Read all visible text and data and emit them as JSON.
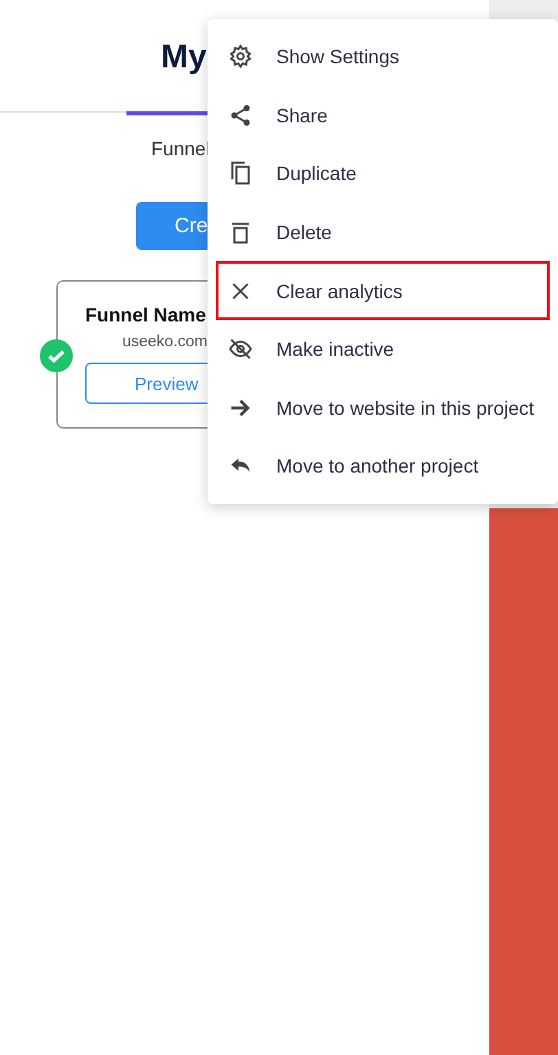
{
  "page": {
    "title": "My",
    "tab_label": "Funnel",
    "create_button": "Cre"
  },
  "funnel_card": {
    "name": "Funnel Name",
    "domain": "useeko.com",
    "active": true,
    "preview_button": "Preview"
  },
  "context_menu": {
    "items": [
      {
        "label": "Show Settings",
        "outlined": false
      },
      {
        "label": "Share",
        "outlined": false
      },
      {
        "label": "Duplicate",
        "outlined": false
      },
      {
        "label": "Delete",
        "outlined": false
      },
      {
        "label": "Clear analytics",
        "outlined": true
      },
      {
        "label": "Make inactive",
        "outlined": false
      },
      {
        "label": "Move to website in this project",
        "outlined": false
      },
      {
        "label": "Move to another project",
        "outlined": false
      }
    ]
  }
}
